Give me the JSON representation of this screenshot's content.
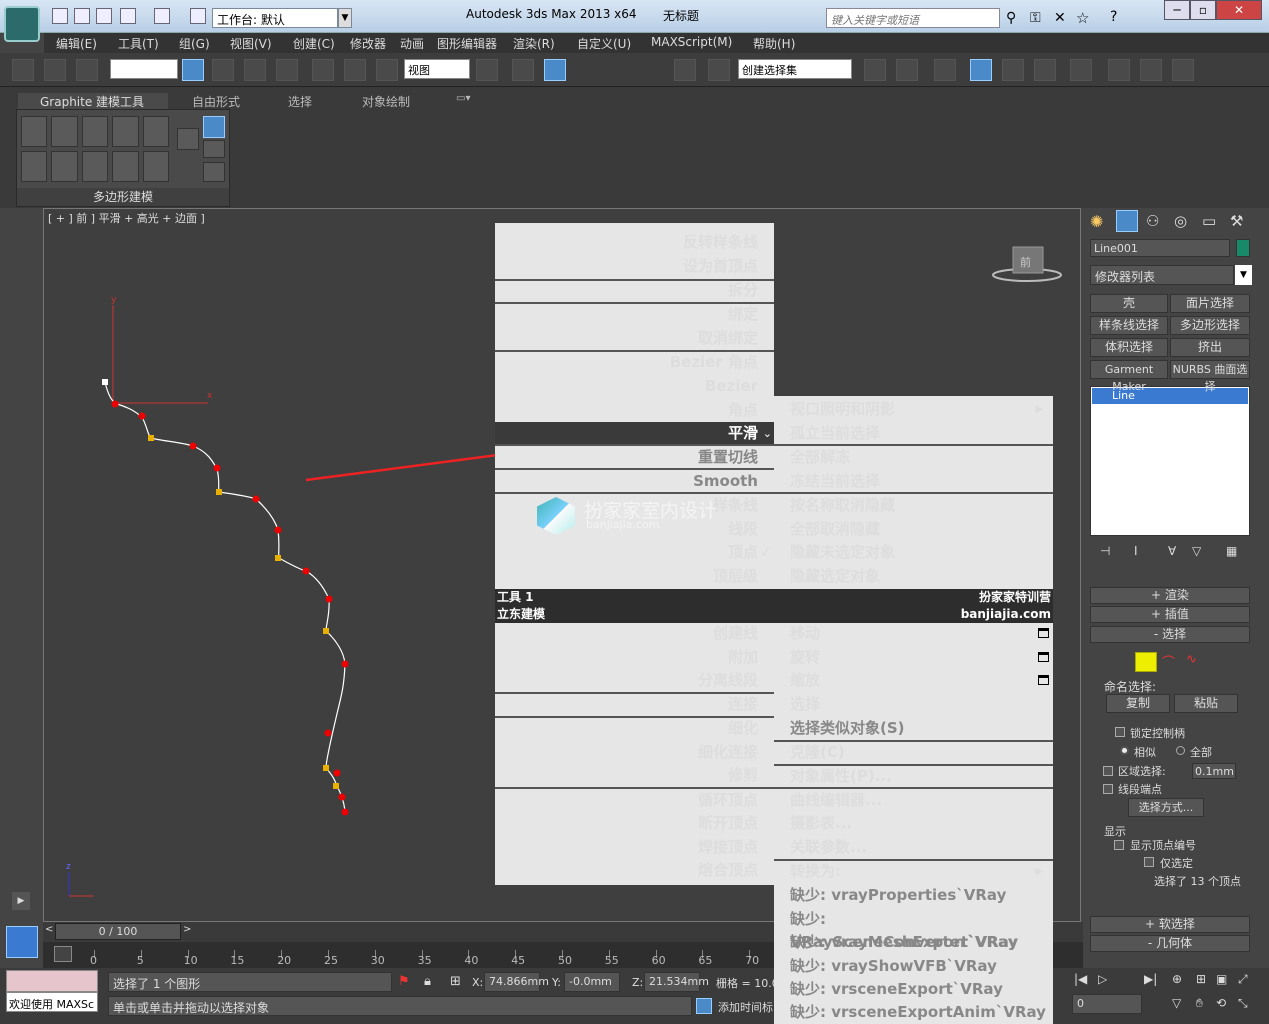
{
  "title_bar": {
    "workspace_label": "工作台: 默认",
    "app_title": "Autodesk 3ds Max  2013 x64",
    "doc_title": "无标题",
    "search_placeholder": "键入关键字或短语"
  },
  "menu": [
    "编辑(E)",
    "工具(T)",
    "组(G)",
    "视图(V)",
    "创建(C)",
    "修改器",
    "动画",
    "图形编辑器",
    "渲染(R)",
    "自定义(U)",
    "MAXScript(M)",
    "帮助(H)"
  ],
  "toolbar": {
    "view_dropdown": "视图",
    "selection_set_dropdown": "创建选择集",
    "snap_3": "3",
    "snap_2": "2",
    "angle_snap_label": "%"
  },
  "ribbon": {
    "tabs": [
      "Graphite 建模工具",
      "自由形式",
      "选择",
      "对象绘制"
    ],
    "panel_label": "多边形建模"
  },
  "viewport": {
    "label": "[ + ] 前 ] 平滑 + 高光 + 边面 ]",
    "gizmo_label": "前",
    "axis_y": "y",
    "axis_x": "x",
    "axis_z": "z",
    "watermark_name": "扮家家室内设计",
    "watermark_url": "banjiajia.com"
  },
  "quad_menu": {
    "left_top": [
      {
        "label": "反转样条线",
        "group": 1
      },
      {
        "label": "设为首顶点",
        "group": 1
      },
      {
        "label": "拆分",
        "group": 2
      },
      {
        "label": "绑定",
        "group": 3
      },
      {
        "label": "取消绑定",
        "group": 3
      },
      {
        "label": "Bezier 角点",
        "group": 4
      },
      {
        "label": "Bezier",
        "group": 4
      },
      {
        "label": "角点",
        "group": 4
      },
      {
        "label": "平滑",
        "group": 4,
        "selected": true
      },
      {
        "label": "重置切线",
        "group": 5,
        "gray": true
      },
      {
        "label": "Smooth",
        "group": 6,
        "gray": true
      },
      {
        "label": "样条线",
        "group": 7
      },
      {
        "label": "线段",
        "group": 7
      },
      {
        "label": "顶点",
        "group": 7,
        "checked": true
      },
      {
        "label": "顶层级",
        "group": 7
      }
    ],
    "right_top": [
      {
        "label": "视口照明和阴影",
        "arrow": true
      },
      {
        "label": "孤立当前选择"
      },
      {
        "label": "全部解冻"
      },
      {
        "label": "冻结当前选择"
      },
      {
        "label": "按名称取消隐藏"
      },
      {
        "label": "全部取消隐藏"
      },
      {
        "label": "隐藏未选定对象"
      },
      {
        "label": "隐藏选定对象"
      }
    ],
    "header_tools1": "工具 1",
    "header_right1": "扮家家特训营",
    "header_left2": "立东建模",
    "header_right2": "banjiajia.com",
    "left_bottom": [
      "创建线",
      "附加",
      "分离线段",
      "连接",
      "细化",
      "细化连接",
      "修剪",
      "循环顶点",
      "断开顶点",
      "焊接顶点",
      "熔合顶点"
    ],
    "right_bottom": [
      {
        "label": "移动",
        "box": true
      },
      {
        "label": "旋转",
        "box": true
      },
      {
        "label": "缩放",
        "box": true
      },
      {
        "label": "选择"
      },
      {
        "label": "选择类似对象(S)",
        "gray": true
      },
      {
        "label": "克隆(C)"
      },
      {
        "label": "对象属性(P)..."
      },
      {
        "label": "曲线编辑器..."
      },
      {
        "label": "摄影表..."
      },
      {
        "label": "关联参数..."
      },
      {
        "label": "转换为:",
        "arrow": true
      },
      {
        "label": "缺少: vrayProperties`VRay",
        "gray": true
      },
      {
        "label": "缺少: VRaySceneConverter`VRay",
        "gray": true
      },
      {
        "label": "缺少: vrayMeshExport`VRay",
        "gray": true
      },
      {
        "label": "缺少: vrayShowVFB`VRay",
        "gray": true
      },
      {
        "label": "缺少: vrsceneExport`VRay",
        "gray": true
      },
      {
        "label": "缺少: vrsceneExportAnim`VRay",
        "gray": true
      }
    ]
  },
  "command_panel": {
    "object_name": "Line001",
    "modifier_list": "修改器列表",
    "buttons": [
      "壳",
      "面片选择",
      "样条线选择",
      "多边形选择",
      "体积选择",
      "挤出",
      "Garment Maker",
      "NURBS 曲面选择"
    ],
    "stack_item": "Line",
    "rollouts": [
      "渲染",
      "插值",
      "选择"
    ],
    "named_selection_label": "命名选择:",
    "copy": "复制",
    "paste": "粘贴",
    "lock_handles": "锁定控制柄",
    "similar": "相似",
    "all": "全部",
    "area_select": "区域选择:",
    "area_value": "0.1mm",
    "segment_end": "线段端点",
    "select_by": "选择方式...",
    "display_label": "显示",
    "show_vertex_numbers": "显示顶点编号",
    "only_selected": "仅选定",
    "status": "选择了 13 个顶点",
    "soft_selection": "软选择",
    "geometry": "几何体"
  },
  "timeline": {
    "frame_display": "0 / 100",
    "ticks": [
      "0",
      "5",
      "10",
      "15",
      "20",
      "25",
      "30",
      "35",
      "40",
      "45",
      "50",
      "55",
      "60",
      "65",
      "70"
    ]
  },
  "status_bar": {
    "welcome": "欢迎使用  MAXSc",
    "selected": "选择了 1 个图形",
    "prompt": "单击或单击并拖动以选择对象",
    "x_label": "X:",
    "x_value": "74.866mm",
    "y_label": "Y:",
    "y_value": "-0.0mm",
    "z_label": "Z:",
    "z_value": "21.534mm",
    "grid": "栅格 = 10.0",
    "add_time_tag": "添加时间标",
    "frame_value": "0"
  }
}
